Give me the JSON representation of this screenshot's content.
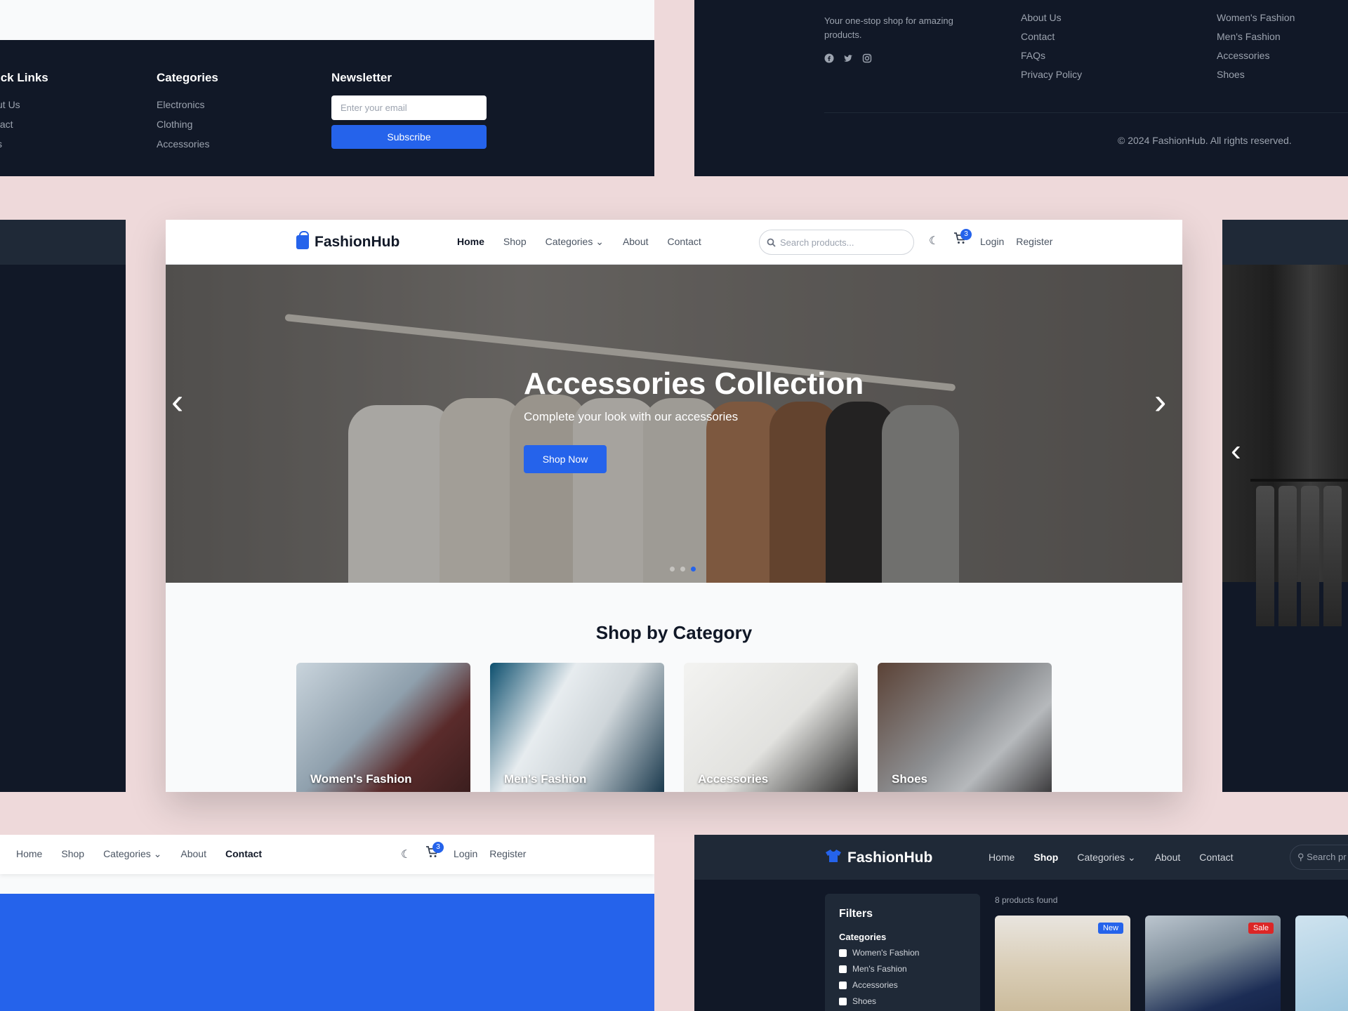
{
  "footer_left": {
    "quick_links_title": "ick Links",
    "quick_links": [
      "ut Us",
      "tact",
      "s"
    ],
    "categories_title": "Categories",
    "categories": [
      "Electronics",
      "Clothing",
      "Accessories"
    ],
    "newsletter_title": "Newsletter",
    "email_placeholder": "Enter your email",
    "subscribe_label": "Subscribe"
  },
  "footer_right": {
    "description": "Your one-stop shop for amazing products.",
    "links": [
      "About Us",
      "Contact",
      "FAQs",
      "Privacy Policy"
    ],
    "categories": [
      "Women's Fashion",
      "Men's Fashion",
      "Accessories",
      "Shoes"
    ],
    "copyright": "© 2024 FashionHub. All rights reserved.",
    "social_icons": [
      "facebook-icon",
      "twitter-icon",
      "instagram-icon"
    ]
  },
  "main": {
    "brand": "FashionHub",
    "nav": [
      "Home",
      "Shop",
      "Categories",
      "About",
      "Contact"
    ],
    "active_nav": "Home",
    "search_placeholder": "Search products...",
    "cart_count": "3",
    "login": "Login",
    "register": "Register",
    "hero": {
      "title": "Accessories Collection",
      "subtitle": "Complete your look with our accessories",
      "button": "Shop Now",
      "slide_count": 3,
      "active_slide": 3
    },
    "section_title": "Shop by Category",
    "categories": [
      "Women's Fashion",
      "Men's Fashion",
      "Accessories",
      "Shoes"
    ]
  },
  "bottom_left": {
    "nav": [
      "Home",
      "Shop",
      "Categories",
      "About",
      "Contact"
    ],
    "active_nav": "Contact",
    "cart_count": "3",
    "login": "Login",
    "register": "Register"
  },
  "bottom_right": {
    "brand": "FashionHub",
    "nav": [
      "Home",
      "Shop",
      "Categories",
      "About",
      "Contact"
    ],
    "active_nav": "Shop",
    "search_placeholder": "Search pr",
    "filters_title": "Filters",
    "categories_title": "Categories",
    "filter_options": [
      "Women's Fashion",
      "Men's Fashion",
      "Accessories",
      "Shoes"
    ],
    "products_found": "8 products found",
    "tags": [
      "New",
      "Sale"
    ]
  },
  "colors": {
    "accent": "#2563eb",
    "dark_bg": "#111827",
    "page_bg": "#eed9da",
    "sale": "#dc2626"
  }
}
